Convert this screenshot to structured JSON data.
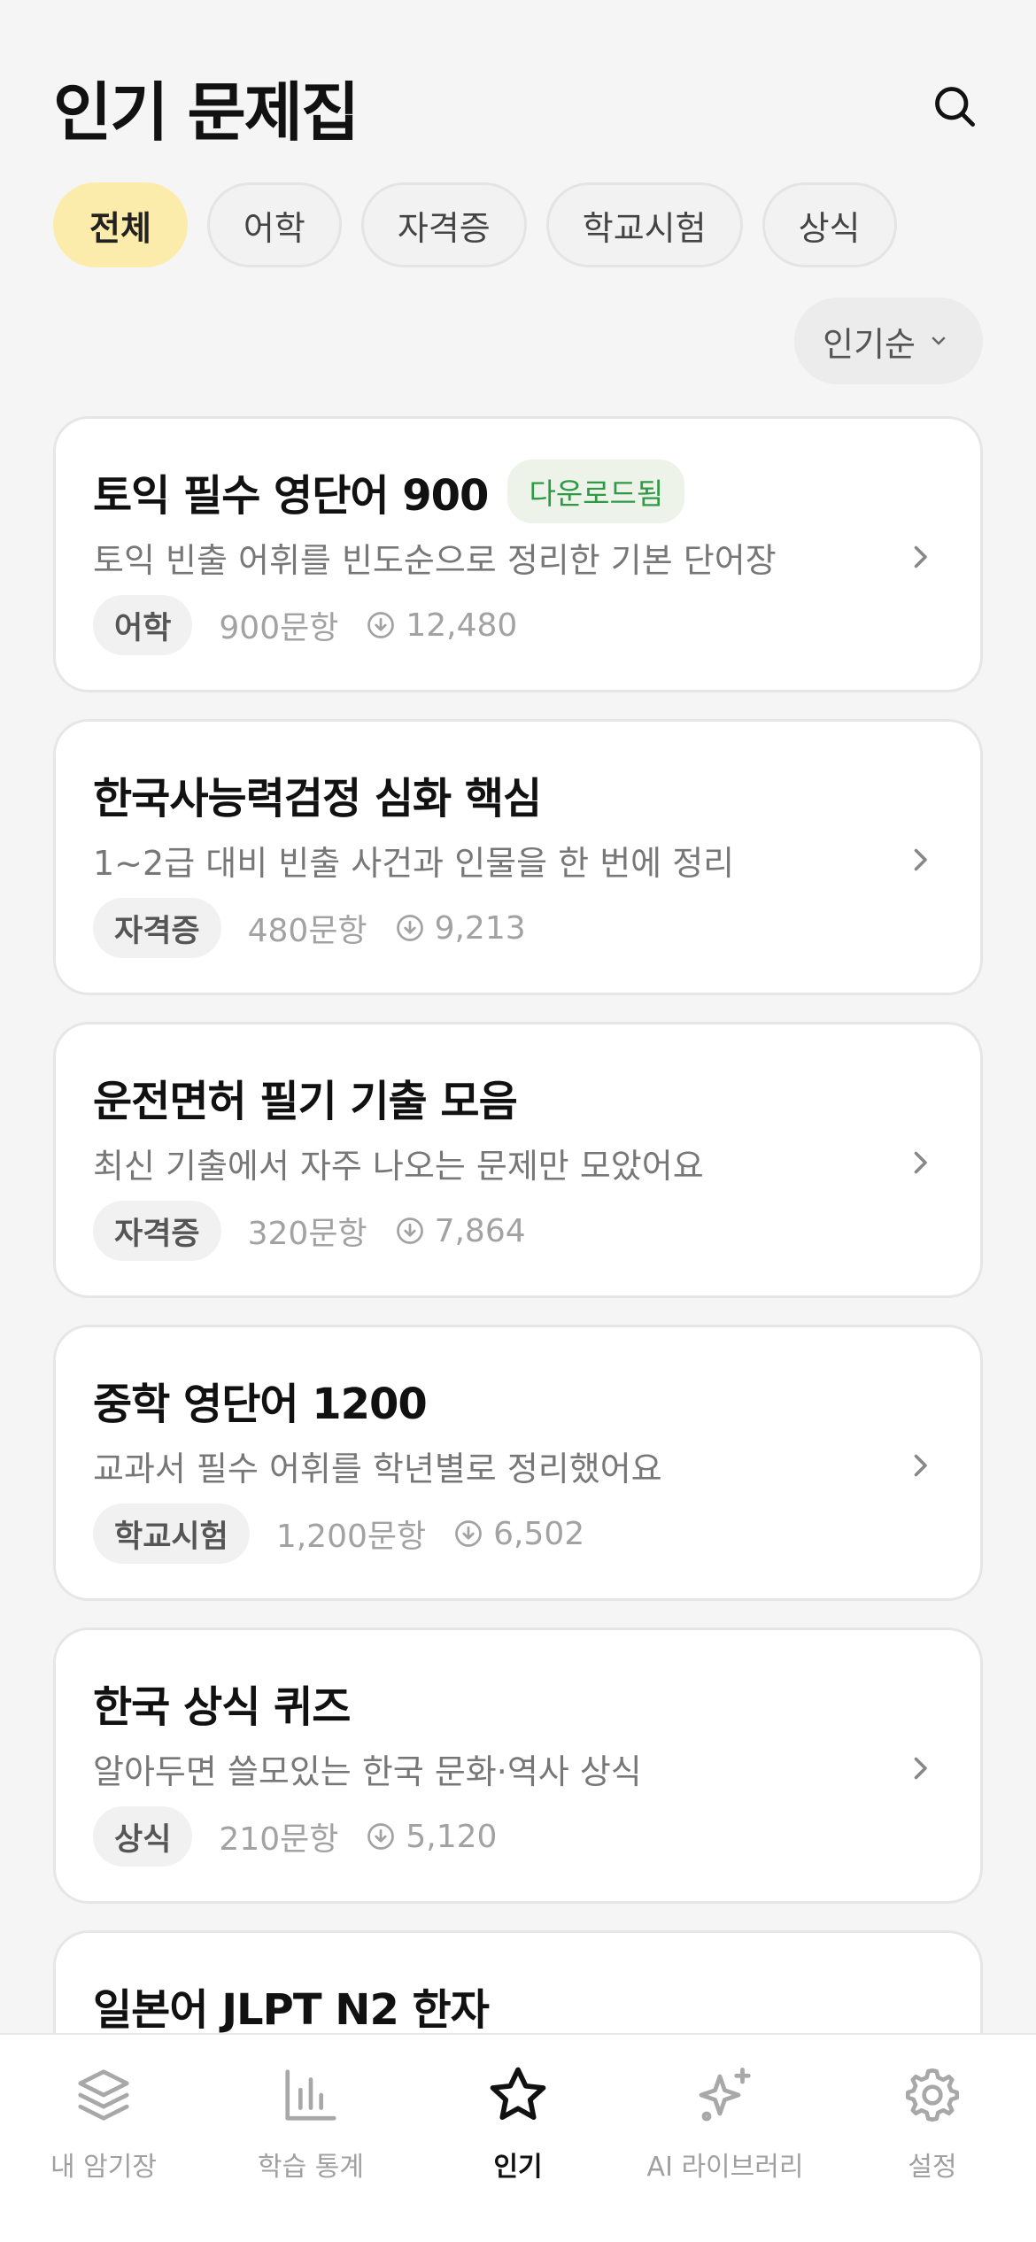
{
  "header": {
    "title": "인기 문제집"
  },
  "filters": [
    "전체",
    "어학",
    "자격증",
    "학교시험",
    "상식"
  ],
  "active_filter_index": 0,
  "sort": {
    "label": "인기순"
  },
  "cards": [
    {
      "title": "토익 필수 영단어 900",
      "badge": "다운로드됨",
      "desc": "토익 빈출 어휘를 빈도순으로 정리한 기본 단어장",
      "category": "어학",
      "count": "900문항",
      "downloads": "12,480"
    },
    {
      "title": "한국사능력검정 심화 핵심",
      "badge": "",
      "desc": "1~2급 대비 빈출 사건과 인물을 한 번에 정리",
      "category": "자격증",
      "count": "480문항",
      "downloads": "9,213"
    },
    {
      "title": "운전면허 필기 기출 모음",
      "badge": "",
      "desc": "최신 기출에서 자주 나오는 문제만 모았어요",
      "category": "자격증",
      "count": "320문항",
      "downloads": "7,864"
    },
    {
      "title": "중학 영단어 1200",
      "badge": "",
      "desc": "교과서 필수 어휘를 학년별로 정리했어요",
      "category": "학교시험",
      "count": "1,200문항",
      "downloads": "6,502"
    },
    {
      "title": "한국 상식 퀴즈",
      "badge": "",
      "desc": "알아두면 쓸모있는 한국 문화·역사 상식",
      "category": "상식",
      "count": "210문항",
      "downloads": "5,120"
    },
    {
      "title": "일본어 JLPT N2 한자",
      "badge": "",
      "desc": "",
      "category": "",
      "count": "",
      "downloads": ""
    }
  ],
  "tabs": [
    {
      "label": "내 암기장",
      "icon": "layers-icon"
    },
    {
      "label": "학습 통계",
      "icon": "bar-chart-icon"
    },
    {
      "label": "인기",
      "icon": "star-icon",
      "active": true
    },
    {
      "label": "AI 라이브러리",
      "icon": "sparkle-icon"
    },
    {
      "label": "설정",
      "icon": "gear-icon"
    }
  ],
  "colors": {
    "accent_chip": "#fcecab",
    "badge_green": "#2f9a45",
    "background": "#f5f5f5"
  }
}
